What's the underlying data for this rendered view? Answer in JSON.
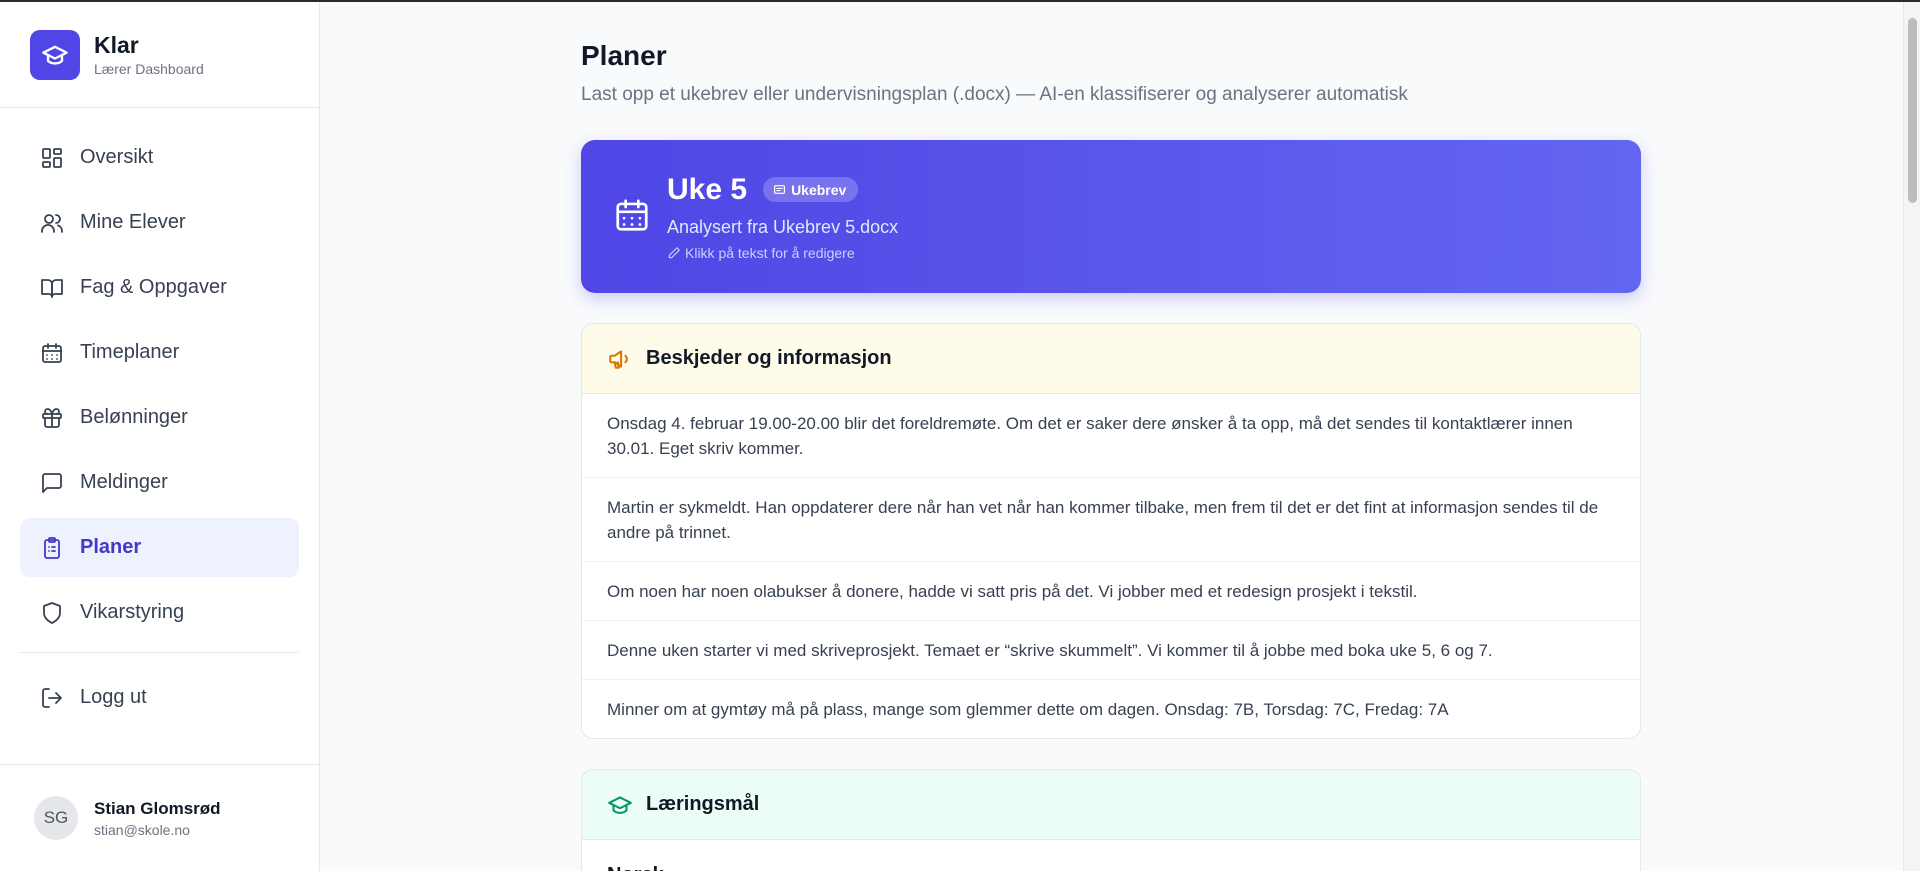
{
  "brand": {
    "title": "Klar",
    "subtitle": "Lærer Dashboard"
  },
  "nav": {
    "items": [
      {
        "label": "Oversikt",
        "icon": "grid-icon"
      },
      {
        "label": "Mine Elever",
        "icon": "users-icon"
      },
      {
        "label": "Fag & Oppgaver",
        "icon": "book-icon"
      },
      {
        "label": "Timeplaner",
        "icon": "calendar-icon"
      },
      {
        "label": "Belønninger",
        "icon": "gift-icon"
      },
      {
        "label": "Meldinger",
        "icon": "message-icon"
      },
      {
        "label": "Planer",
        "icon": "clipboard-icon",
        "active": true
      },
      {
        "label": "Vikarstyring",
        "icon": "shield-icon"
      }
    ],
    "logout": "Logg ut"
  },
  "user": {
    "initials": "SG",
    "name": "Stian Glomsrød",
    "email": "stian@skole.no"
  },
  "page": {
    "title": "Planer",
    "subtitle": "Last opp et ukebrev eller undervisningsplan (.docx) — AI-en klassifiserer og analyserer automatisk"
  },
  "hero": {
    "title": "Uke 5",
    "badge": "Ukebrev",
    "subtitle": "Analysert fra Ukebrev 5.docx",
    "hint": "Klikk på tekst for å redigere"
  },
  "messages": {
    "title": "Beskjeder og informasjon",
    "items": [
      "Onsdag 4. februar 19.00-20.00 blir det foreldremøte. Om det er saker dere ønsker å ta opp, må det sendes til kontaktlærer innen 30.01. Eget skriv kommer.",
      "Martin er sykmeldt. Han oppdaterer dere når han vet når han kommer tilbake, men frem til det er det fint at informasjon sendes til de andre på trinnet.",
      "Om noen har noen olabukser å donere, hadde vi satt pris på det. Vi jobber med et redesign prosjekt i tekstil.",
      "Denne uken starter vi med skriveprosjekt. Temaet er “skrive skummelt”. Vi kommer til å jobbe med boka uke 5, 6 og 7.",
      "Minner om at gymtøy må på plass, mange som glemmer dette om dagen. Onsdag: 7B, Torsdag: 7C, Fredag: 7A"
    ]
  },
  "goals": {
    "title": "Læringsmål",
    "first_subject": "Norsk"
  },
  "colors": {
    "accent": "#4f46e5",
    "hero_end": "#6366f1",
    "warning_bg": "#fefce8",
    "success_bg": "#ecfdf5"
  }
}
